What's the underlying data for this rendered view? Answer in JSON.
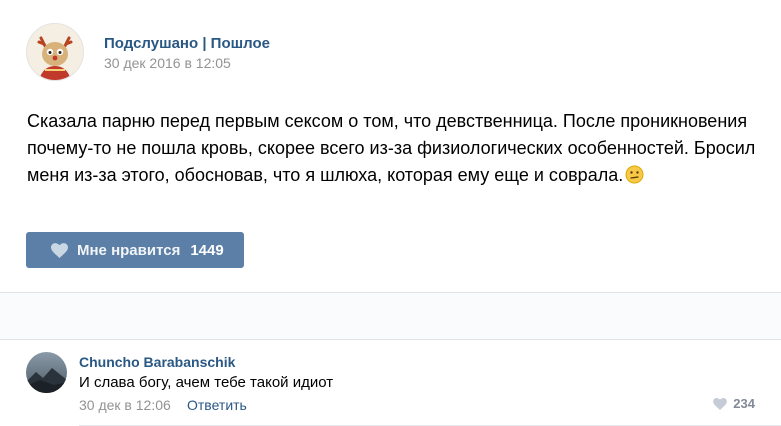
{
  "post": {
    "author": "Подслушано | Пошлое",
    "date": "30 дек 2016 в 12:05",
    "text": "Сказала парню перед первым сексом о том, что девственница. После проникновения почему-то не пошла кровь, скорее всего из-за физиологических особенностей. Бросил меня из-за этого, обосновав, что я шлюха, которая ему еще и соврала.",
    "emoji": "confused-face-emoji",
    "like_label": "Мне нравится",
    "like_count": "1449"
  },
  "comment": {
    "author": "Chuncho Barabanschik",
    "text": "И слава богу, ачем тебе такой идиот",
    "date": "30 дек в 12:06",
    "reply_label": "Ответить",
    "like_count": "234"
  },
  "colors": {
    "link": "#2a5885",
    "like_button": "#5b7fa6",
    "muted": "#939393"
  }
}
